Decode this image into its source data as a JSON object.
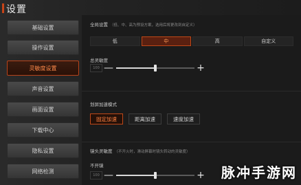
{
  "window": {
    "title": "设置"
  },
  "sidebar": {
    "items": [
      {
        "label": "基础设置",
        "active": false
      },
      {
        "label": "操作设置",
        "active": false
      },
      {
        "label": "灵敏度设置",
        "active": true
      },
      {
        "label": "声音设置",
        "active": false
      },
      {
        "label": "画面设置",
        "active": false
      },
      {
        "label": "下载中心",
        "active": false
      },
      {
        "label": "隐私设置",
        "active": false
      },
      {
        "label": "网络检测",
        "active": false
      }
    ]
  },
  "global": {
    "label": "全局设置",
    "hint": "（低、中、高为预设方案，选用后将更改到自定义）",
    "presets": [
      {
        "label": "低",
        "active": false
      },
      {
        "label": "中",
        "active": true
      },
      {
        "label": "高",
        "active": false
      },
      {
        "label": "自定义",
        "active": false
      }
    ]
  },
  "sensitivity": {
    "label": "总灵敏度",
    "value": "100",
    "minus": "—",
    "plus": "+",
    "level": 0.5
  },
  "acceleration": {
    "label": "划屏加速模式",
    "modes": [
      {
        "label": "固定加速",
        "active": true
      },
      {
        "label": "距离加速",
        "active": false
      },
      {
        "label": "速度加速",
        "active": false
      }
    ]
  },
  "lens": {
    "label": "镜头灵敏度",
    "hint": "（不开火时，滑动屏幕时镜头转动的灵敏度）",
    "sub_label": "不开镜",
    "value": "100",
    "minus": "—",
    "plus": "+",
    "level": 0.5
  },
  "watermark": "脉冲手游网",
  "colors": {
    "accent": "#c04818",
    "accent_text": "#ff8040",
    "background": "#1b1b1b"
  }
}
